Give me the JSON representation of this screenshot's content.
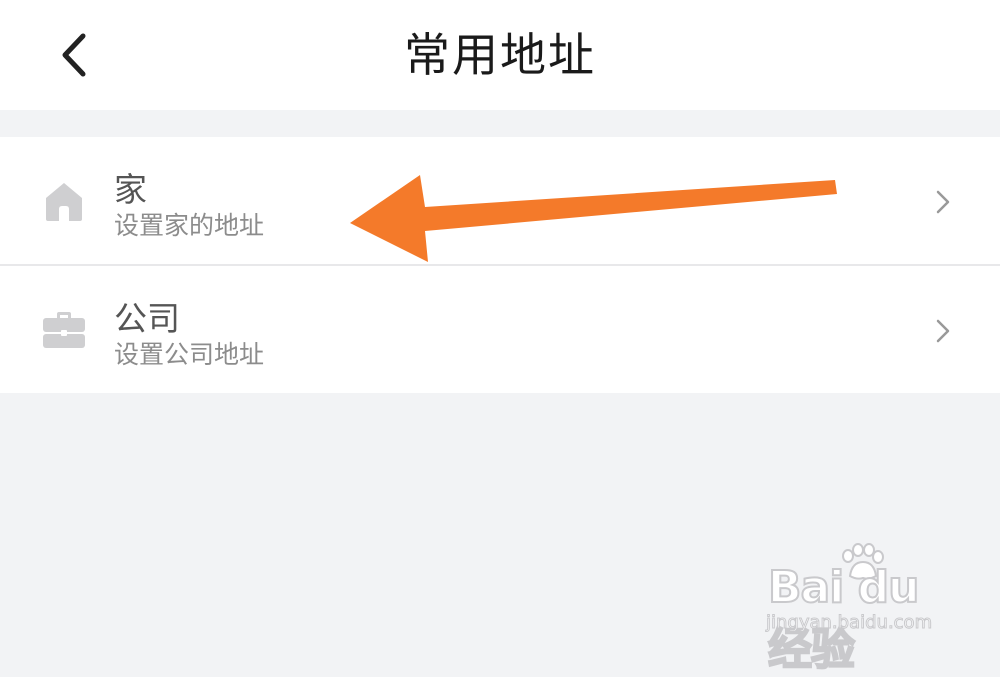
{
  "header": {
    "title": "常用地址",
    "back_icon": "chevron-left-icon"
  },
  "addresses": [
    {
      "title": "家",
      "subtitle": "设置家的地址",
      "icon": "home-icon"
    },
    {
      "title": "公司",
      "subtitle": "设置公司地址",
      "icon": "briefcase-icon"
    }
  ],
  "annotation": {
    "arrow_color": "#f47a2a"
  },
  "watermark": {
    "logo": "Bai du 经验",
    "url": "jingyan.baidu.com"
  },
  "colors": {
    "background": "#f2f3f5",
    "icon_gray": "#cfcfd1"
  }
}
